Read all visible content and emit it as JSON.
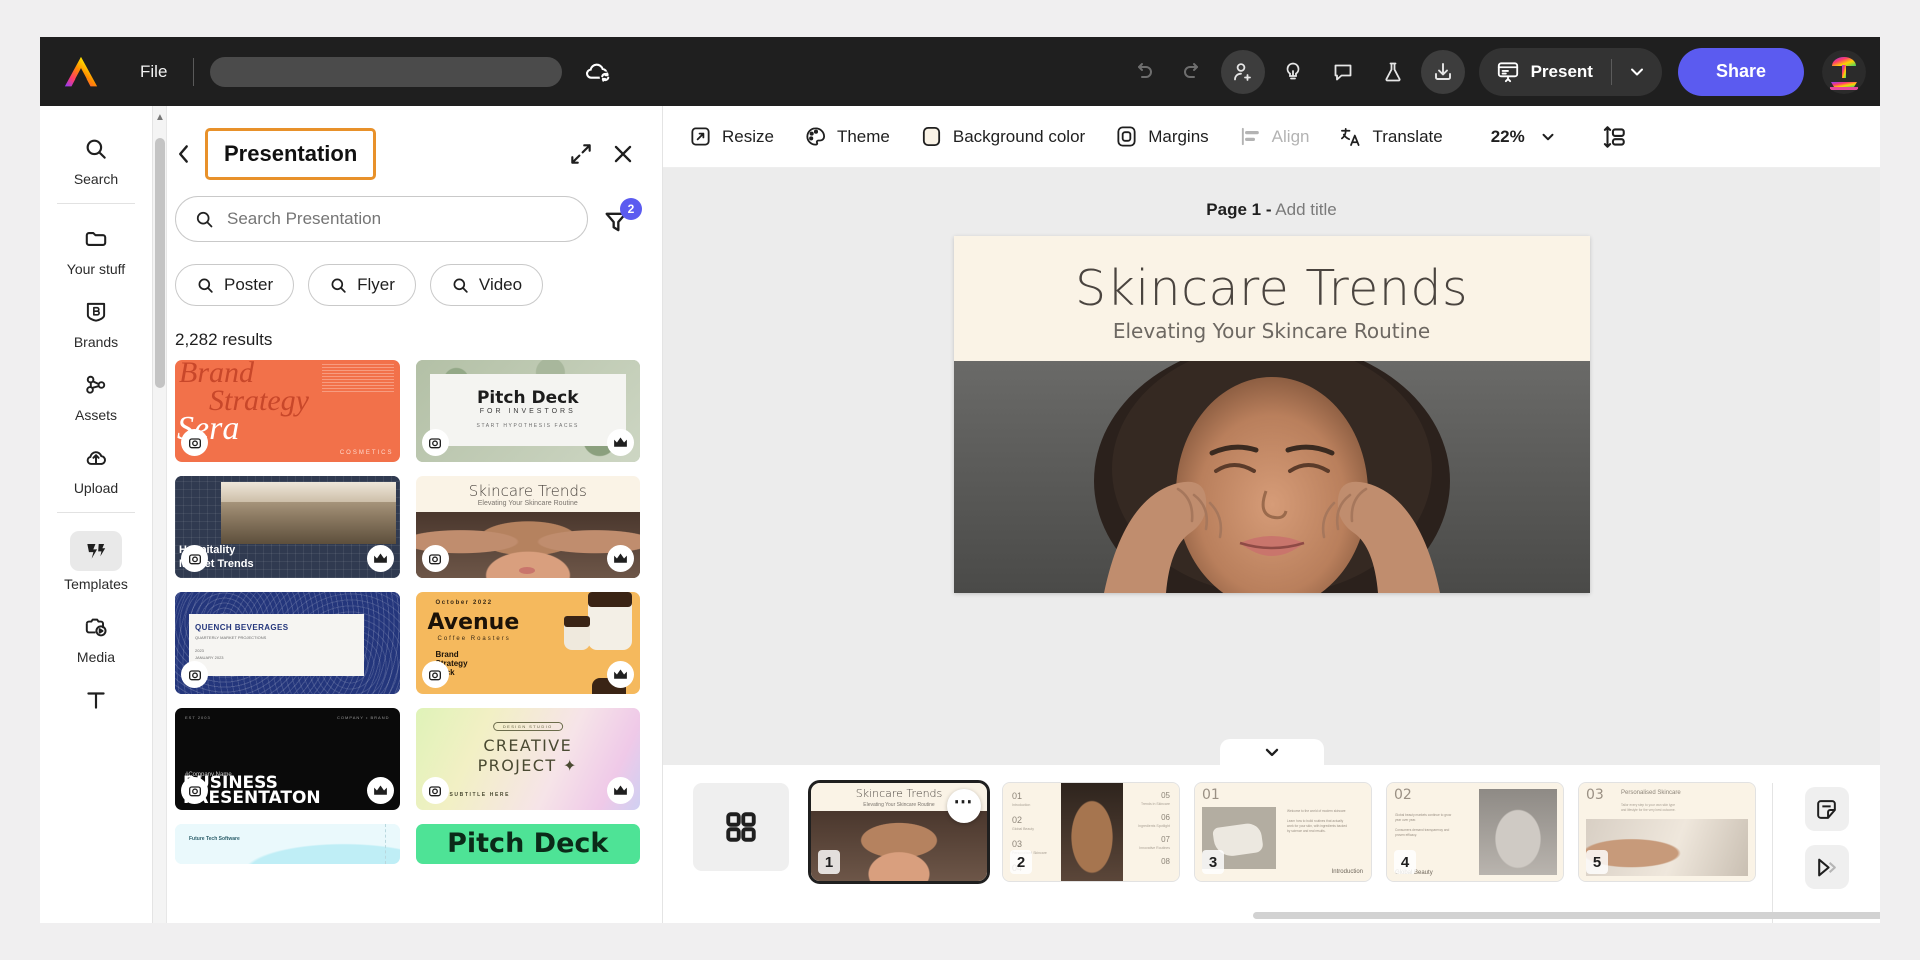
{
  "topbar": {
    "logo_icon": "adobe-express-logo",
    "file_menu": "File",
    "document_title": "",
    "document_title_placeholder": "",
    "cloud_icon": "cloud-sync-icon",
    "undo_icon": "undo-icon",
    "redo_icon": "redo-icon",
    "invite_icon": "add-person-icon",
    "ideas_icon": "lightbulb-icon",
    "comments_icon": "comment-icon",
    "labs_icon": "flask-icon",
    "download_icon": "download-icon",
    "present_icon": "present-icon",
    "present_label": "Present",
    "present_caret_icon": "chevron-down-icon",
    "share_label": "Share",
    "avatar_icon": "user-avatar",
    "accent_purple": "#5b5bf0",
    "bar_bg": "#1f1f1f"
  },
  "rail": {
    "items": [
      {
        "label": "Search",
        "icon": "search-icon",
        "active": false
      },
      {
        "label": "Your stuff",
        "icon": "folder-icon",
        "active": false
      },
      {
        "label": "Brands",
        "icon": "brand-shield-icon",
        "active": false
      },
      {
        "label": "Assets",
        "icon": "assets-nodes-icon",
        "active": false
      },
      {
        "label": "Upload",
        "icon": "upload-cloud-icon",
        "active": false
      },
      {
        "label": "Templates",
        "icon": "templates-icon",
        "active": true
      },
      {
        "label": "Media",
        "icon": "media-icon",
        "active": false
      },
      {
        "label": "Text",
        "icon": "text-icon",
        "active": false
      }
    ]
  },
  "panel": {
    "back_icon": "chevron-left-icon",
    "title": "Presentation",
    "title_highlight_color": "#e8912a",
    "expand_icon": "expand-diagonal-icon",
    "close_icon": "close-icon",
    "search": {
      "icon": "search-icon",
      "value": "",
      "placeholder": "Search Presentation"
    },
    "filter": {
      "icon": "filter-funnel-icon",
      "badge": "2",
      "badge_color": "#5b5bf0"
    },
    "chips": [
      {
        "label": "Poster",
        "icon": "search-icon"
      },
      {
        "label": "Flyer",
        "icon": "search-icon"
      },
      {
        "label": "Video",
        "icon": "search-icon"
      }
    ],
    "results_count": "2,282 results",
    "templates": [
      {
        "name": "Brand Strategy Sera Cosmetics",
        "title": "Brand Strategy",
        "sub": "Sera",
        "tag": "COSMETICS",
        "bg": "#f2714a",
        "premium": false,
        "kind": "brand-strategy"
      },
      {
        "name": "Pitch Deck For Investors",
        "title": "Pitch Deck",
        "sub": "FOR INVESTORS",
        "bg": "#c3cbbd",
        "premium": true,
        "kind": "pitch-deck-nature"
      },
      {
        "name": "Hospitality Market Trends",
        "title": "Hospitality",
        "sub": "Market Trends",
        "bg": "#303a50",
        "premium": true,
        "kind": "hospitality"
      },
      {
        "name": "Skincare Trends",
        "title": "Skincare Trends",
        "sub": "Elevating Your Skincare Routine",
        "bg": "#faf3e6",
        "premium": true,
        "kind": "skincare"
      },
      {
        "name": "Quench Beverages",
        "title": "QUENCH BEVERAGES",
        "sub": "",
        "bg": "#24367c",
        "premium": false,
        "kind": "quench"
      },
      {
        "name": "Avenue Coffee Roasters",
        "title": "Avenue",
        "sub": "Coffee Roasters",
        "tag": "October 2022",
        "extra": "Brand Strategy Deck",
        "bg": "#f5b95d",
        "premium": true,
        "kind": "avenue"
      },
      {
        "name": "Business Presentation",
        "title": "BUSINESS PRESENTATON",
        "sub": "#Company Name",
        "bg": "#0a0a0a",
        "premium": true,
        "kind": "business"
      },
      {
        "name": "Creative Project",
        "title": "CREATIVE PROJECT",
        "sub": "SUBTITLE HERE",
        "bg": "#e7f2c0",
        "premium": true,
        "kind": "creative"
      },
      {
        "name": "Future Tech Software",
        "title": "Future Tech Software",
        "sub": "",
        "bg": "#e4f8fb",
        "premium": false,
        "kind": "futuretech"
      },
      {
        "name": "Pitch Deck Green",
        "title": "Pitch Deck",
        "sub": "",
        "bg": "#4ee396",
        "premium": false,
        "kind": "pitchgreen"
      }
    ]
  },
  "context_toolbar": {
    "items": [
      {
        "label": "Resize",
        "icon": "resize-icon",
        "disabled": false
      },
      {
        "label": "Theme",
        "icon": "palette-icon",
        "disabled": false
      },
      {
        "label": "Background color",
        "icon": "background-swatch-icon",
        "disabled": false
      },
      {
        "label": "Margins",
        "icon": "margins-icon",
        "disabled": false
      },
      {
        "label": "Align",
        "icon": "align-icon",
        "disabled": true
      },
      {
        "label": "Translate",
        "icon": "translate-icon",
        "disabled": false
      }
    ],
    "zoom_value": "22%",
    "zoom_caret_icon": "chevron-down-icon",
    "fit_icon": "fit-to-screen-icon"
  },
  "canvas": {
    "page_prefix": "Page 1 -",
    "page_title_placeholder": "Add title",
    "slide": {
      "title": "Skincare Trends",
      "subtitle": "Elevating Your Skincare Routine",
      "bg_color": "#faf3e6",
      "photo_alt": "woman touching face skincare photo"
    }
  },
  "filmstrip": {
    "collapse_icon": "chevron-down-icon",
    "grid_view_icon": "grid-view-icon",
    "more_icon": "more-options-icon",
    "pages": [
      {
        "number": "1",
        "selected": true,
        "kind": "skincare-cover",
        "title": "Skincare Trends",
        "sub": "Elevating Your Skincare Routine"
      },
      {
        "number": "2",
        "selected": false,
        "kind": "numbered-list",
        "labels": [
          "01",
          "02",
          "03",
          "04",
          "05",
          "06",
          "07",
          "08"
        ]
      },
      {
        "number": "3",
        "selected": false,
        "kind": "intro",
        "heading": "01",
        "footer": "Introduction"
      },
      {
        "number": "4",
        "selected": false,
        "kind": "beauty",
        "heading": "02",
        "footer": "Global Beauty"
      },
      {
        "number": "5",
        "selected": false,
        "kind": "personalised",
        "heading": "03",
        "footer": "Personalised Skincare"
      }
    ],
    "notes_icon": "notes-icon",
    "play_icon": "play-next-icon"
  }
}
